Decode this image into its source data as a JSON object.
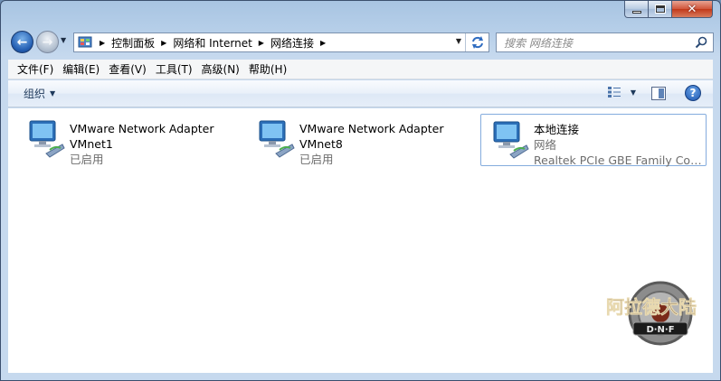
{
  "breadcrumb": [
    "控制面板",
    "网络和 Internet",
    "网络连接"
  ],
  "search": {
    "placeholder": "搜索 网络连接"
  },
  "menu": [
    "文件(F)",
    "编辑(E)",
    "查看(V)",
    "工具(T)",
    "高级(N)",
    "帮助(H)"
  ],
  "toolbar": {
    "organize_label": "组织"
  },
  "connections": [
    {
      "name": "VMware Network Adapter",
      "line2": "VMnet1",
      "line3": "已启用"
    },
    {
      "name": "VMware Network Adapter",
      "line2": "VMnet8",
      "line3": "已启用"
    },
    {
      "name": "本地连接",
      "line2": "网络",
      "line3": "Realtek PCIe GBE Family Contr..."
    }
  ],
  "watermark": {
    "text": "阿拉德大陆",
    "sub": "D·N·F"
  },
  "colors": {
    "accent": "#245fb3",
    "selection_border": "#84acdd",
    "close_red": "#c1391a"
  }
}
